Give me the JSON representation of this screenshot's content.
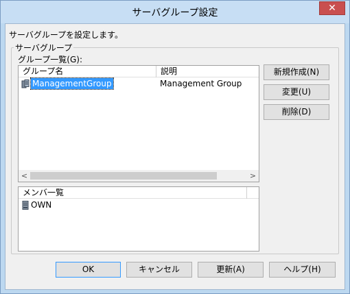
{
  "window": {
    "title": "サーバグループ設定",
    "close_label": "✕"
  },
  "description": "サーバグループを設定します。",
  "group_box": {
    "legend": "サーバグループ",
    "list_label": "グループ一覧(G):",
    "groups_list": {
      "columns": [
        "グループ名",
        "説明"
      ],
      "rows": [
        {
          "name": "ManagementGroup",
          "description": "Management Group",
          "selected": true,
          "icon": "server-group-icon"
        }
      ],
      "scroll_left": "<",
      "scroll_right": ">"
    },
    "members_list": {
      "columns": [
        "メンバ一覧"
      ],
      "rows": [
        {
          "name": "OWN",
          "icon": "server-icon"
        }
      ]
    },
    "buttons": {
      "new": "新規作成(N)",
      "edit": "変更(U)",
      "delete": "削除(D)"
    }
  },
  "footer": {
    "ok": "OK",
    "cancel": "キャンセル",
    "update": "更新(A)",
    "help": "ヘルプ(H)"
  },
  "colors": {
    "selection": "#3399ff",
    "titlebar": "#c7def4",
    "close_button": "#c94f4f"
  }
}
